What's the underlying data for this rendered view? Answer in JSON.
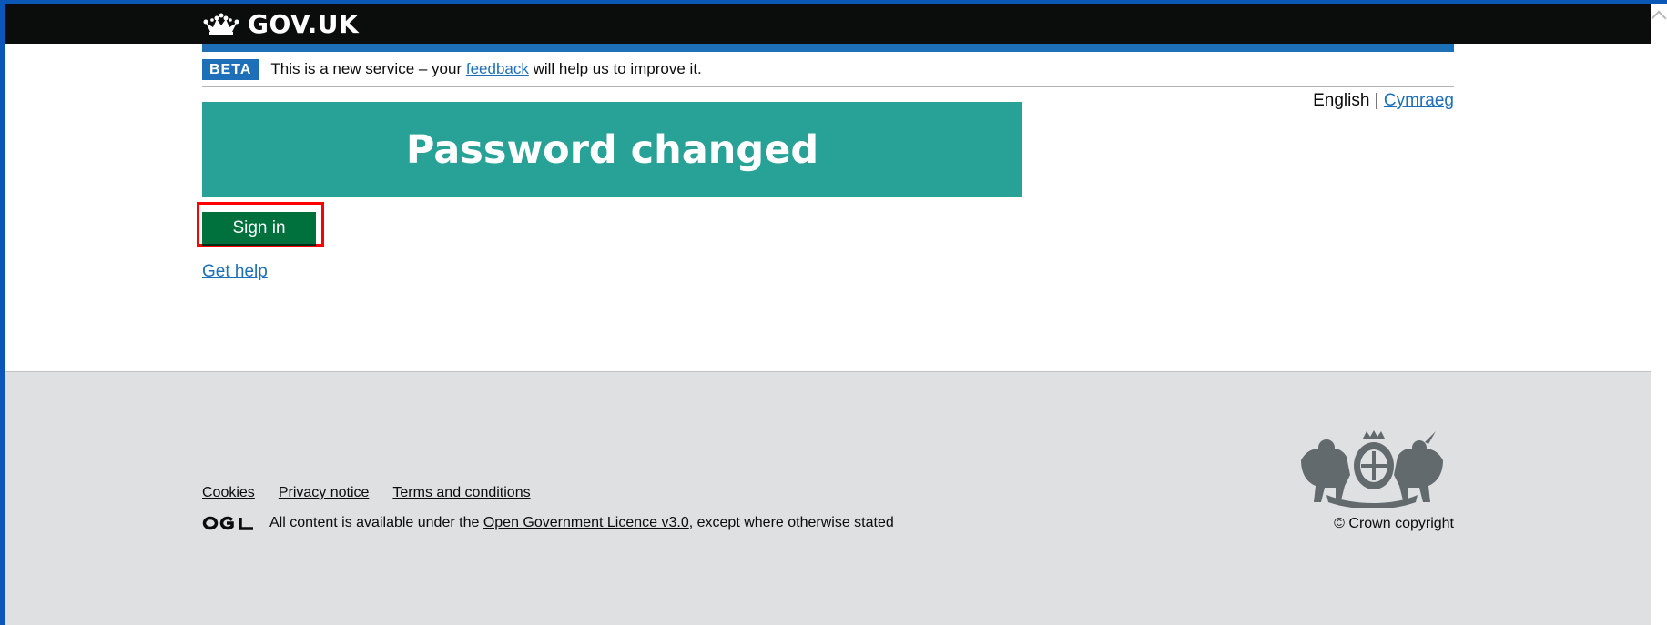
{
  "header": {
    "logo_text": "GOV.UK",
    "logo_icon": "crown-icon"
  },
  "phase_banner": {
    "tag": "BETA",
    "text_before": "This is a new service – your",
    "link_text": "feedback",
    "text_after": "will help us to improve it."
  },
  "language": {
    "current": "English",
    "separator": "|",
    "alternate": "Cymraeg"
  },
  "panel": {
    "title": "Password changed"
  },
  "actions": {
    "sign_in_label": "Sign in",
    "get_help_label": "Get help"
  },
  "footer": {
    "links": [
      "Cookies",
      "Privacy notice",
      "Terms and conditions"
    ],
    "licence_logo": "OGL",
    "licence_before": "All content is available under the",
    "licence_link": "Open Government Licence v3.0",
    "licence_after": ", except where otherwise stated",
    "crest_icon": "royal-coat-of-arms-icon",
    "copyright": "© Crown copyright"
  },
  "colors": {
    "header_bg": "#0b0c0c",
    "brand_blue": "#1d70b8",
    "panel_green": "#28a197",
    "button_green": "#00703c",
    "footer_bg": "#dee0e2",
    "highlight_red": "#ff0000"
  }
}
